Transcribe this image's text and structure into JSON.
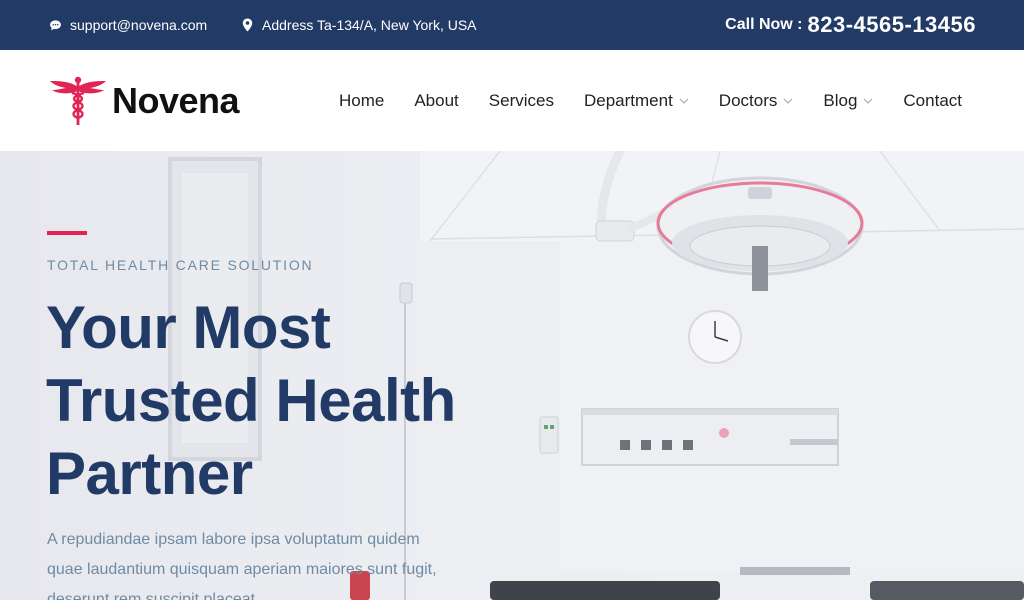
{
  "topbar": {
    "email": "support@novena.com",
    "address": "Address Ta-134/A, New York, USA",
    "call_label": "Call Now :",
    "call_number": "823-4565-13456",
    "bg_color": "#223a66"
  },
  "brand": {
    "name": "Novena",
    "icon": "caduceus-icon",
    "accent_color": "#e12454"
  },
  "nav": {
    "items": [
      {
        "label": "Home",
        "dropdown": false
      },
      {
        "label": "About",
        "dropdown": false
      },
      {
        "label": "Services",
        "dropdown": false
      },
      {
        "label": "Department",
        "dropdown": true
      },
      {
        "label": "Doctors",
        "dropdown": true
      },
      {
        "label": "Blog",
        "dropdown": true
      },
      {
        "label": "Contact",
        "dropdown": false
      }
    ]
  },
  "hero": {
    "subtitle": "TOTAL HEALTH CARE SOLUTION",
    "title": "Your Most Trusted Health Partner",
    "text": "A repudiandae ipsam labore ipsa voluptatum quidem quae laudantium quisquam aperiam maiores sunt fugit, deserunt rem suscipit placeat.",
    "heading_color": "#223a66",
    "body_color": "#6f8ba4"
  }
}
